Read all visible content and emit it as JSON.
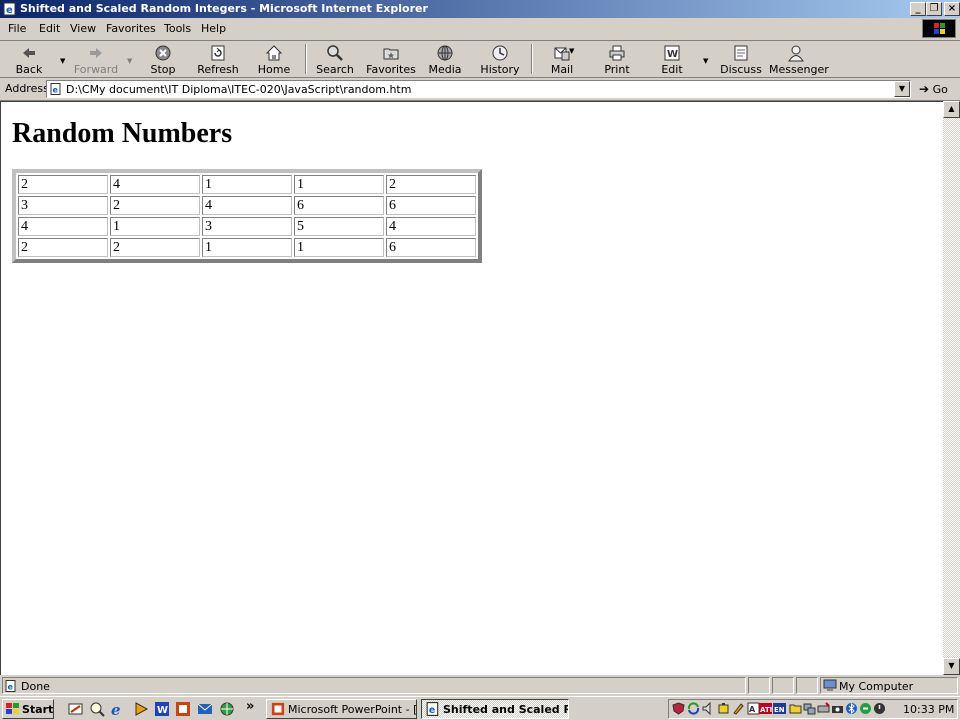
{
  "window": {
    "title": "Shifted and Scaled Random Integers - Microsoft Internet Explorer",
    "minimize": "_",
    "restore": "❐",
    "close": "×"
  },
  "menu": [
    "File",
    "Edit",
    "View",
    "Favorites",
    "Tools",
    "Help"
  ],
  "toolbar": {
    "back": "Back",
    "forward": "Forward",
    "stop": "Stop",
    "refresh": "Refresh",
    "home": "Home",
    "search": "Search",
    "favorites": "Favorites",
    "media": "Media",
    "history": "History",
    "mail": "Mail",
    "print": "Print",
    "edit": "Edit",
    "discuss": "Discuss",
    "messenger": "Messenger"
  },
  "address": {
    "label": "Address",
    "value": "D:\\CMy document\\IT Diploma\\ITEC-020\\JavaScript\\random.htm",
    "go": "Go"
  },
  "page": {
    "heading": "Random Numbers",
    "table": [
      [
        "2",
        "4",
        "1",
        "1",
        "2"
      ],
      [
        "3",
        "2",
        "4",
        "6",
        "6"
      ],
      [
        "4",
        "1",
        "3",
        "5",
        "4"
      ],
      [
        "2",
        "2",
        "1",
        "1",
        "6"
      ]
    ]
  },
  "status": {
    "text": "Done",
    "zone": "My Computer"
  },
  "taskbar": {
    "start": "Start",
    "chevron": "»",
    "tasks": [
      "Microsoft PowerPoint - [J...",
      "Shifted and Scaled Ra..."
    ],
    "clock": "10:33 PM"
  },
  "colors": {
    "title_gradient_start": "#0a246a",
    "title_gradient_end": "#a6caf0",
    "chrome": "#d4d0c8",
    "page_background": "#ffffff"
  }
}
